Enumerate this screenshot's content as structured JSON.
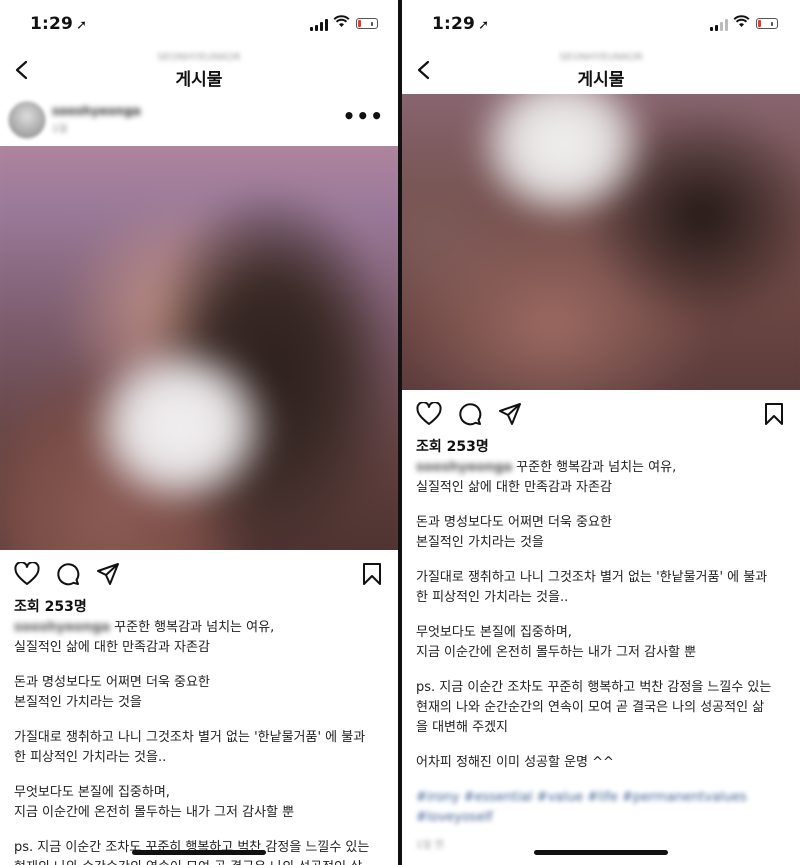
{
  "status_bar": {
    "time": "1:29",
    "location_arrow": "location-arrow-icon"
  },
  "header": {
    "title": "게시물",
    "subtitle": "SEONHYEUNKOR"
  },
  "post": {
    "username": "sooshyeonga",
    "subtitle": "1일",
    "views": "조회 253명",
    "caption_username": "sooshyeonga",
    "caption_paragraphs": [
      [
        "꾸준한 행복감과 넘치는 여유,",
        "실질적인 삶에 대한 만족감과 자존감"
      ],
      [
        "돈과 명성보다도 어쩌면 더욱 중요한",
        "본질적인 가치라는 것을"
      ],
      [
        "가질대로 쟁취하고 나니 그것조차 별거 없는 '한낱물거품' 에 불과",
        "한 피상적인 가치라는 것을.."
      ],
      [
        "무엇보다도 본질에 집중하며,",
        "지금 이순간에 온전히 몰두하는 내가 그저 감사할 뿐"
      ],
      [
        "ps. 지금 이순간 조차도 꾸준히 행복하고 벅찬 감정을 느낄수 있는",
        "현재의 나와 순간순간의 연속이 모여 곧 결국은 나의 성공적인 삶",
        "을 대변해 주겠지"
      ],
      [
        "어차피 정해진 이미 성공할 운명 ^^"
      ]
    ],
    "hashtags": "#irony #essential #value #life #permanentvalues #loveyoself",
    "date": "1일 전"
  },
  "icons": [
    "back-chevron-icon",
    "more-icon",
    "heart-icon",
    "comment-icon",
    "share-icon",
    "bookmark-icon",
    "signal-icon",
    "wifi-icon",
    "battery-icon"
  ],
  "colors": {
    "battery_low": "#e53935",
    "hashtag": "#3b5f93"
  }
}
